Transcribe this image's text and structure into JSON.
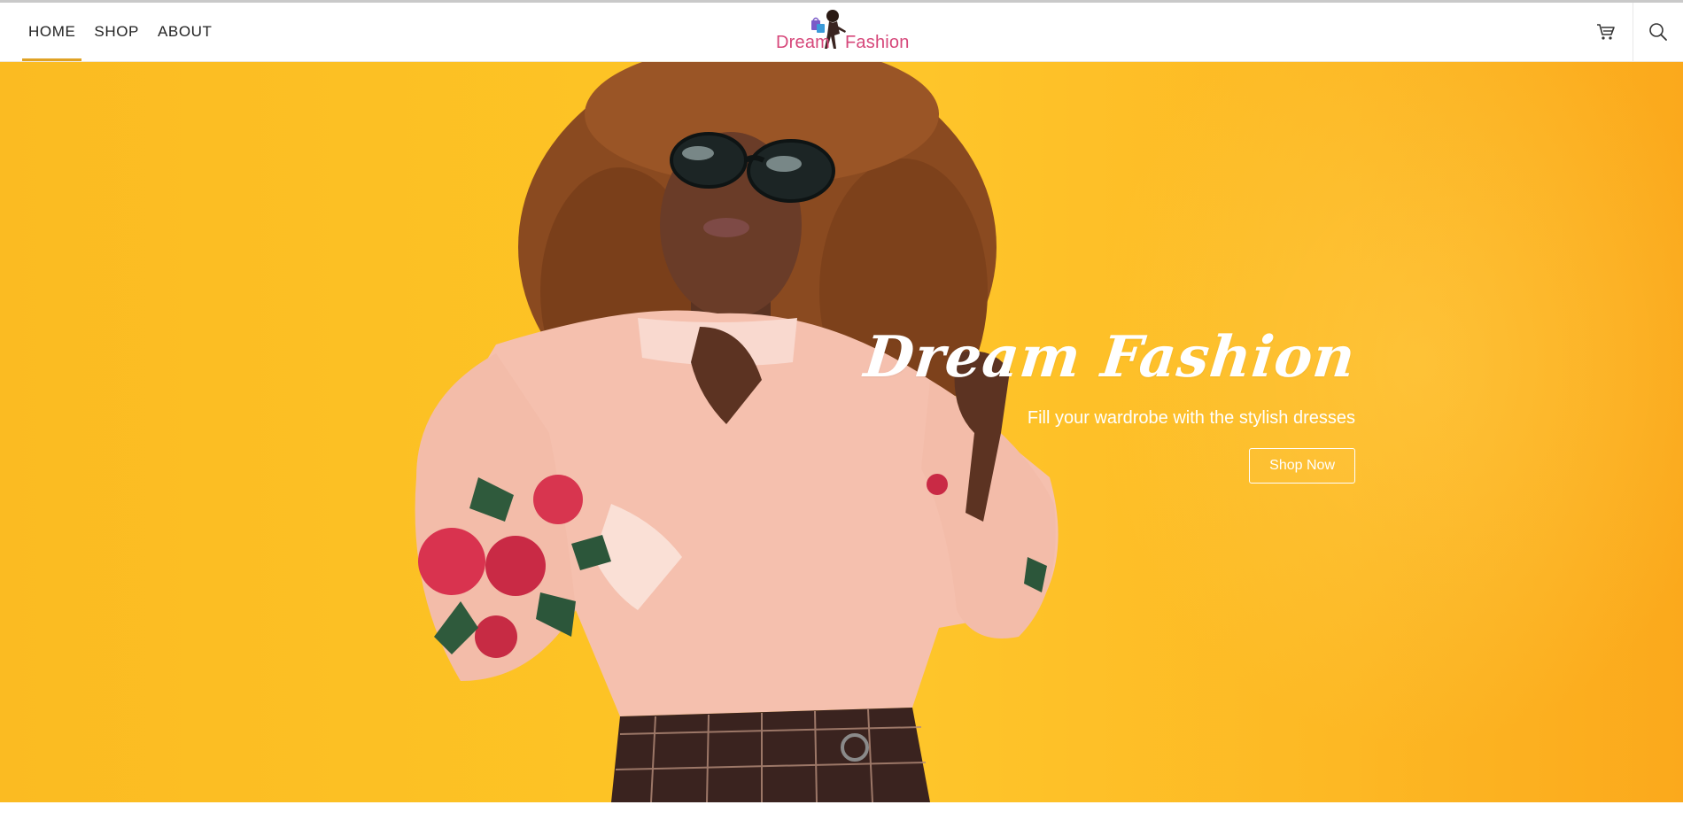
{
  "header": {
    "nav": [
      {
        "label": "HOME",
        "active": true
      },
      {
        "label": "SHOP",
        "active": false
      },
      {
        "label": "ABOUT",
        "active": false
      }
    ],
    "logo": {
      "word_left": "Dream",
      "word_right": "Fashion",
      "color": "#d6477a"
    },
    "icons": {
      "cart": "cart-icon",
      "search": "search-icon"
    },
    "accent_color": "#e0a325"
  },
  "hero": {
    "title": "Dream Fashion",
    "subtitle": "Fill your wardrobe with the stylish dresses",
    "button_label": "Shop Now",
    "background_color": "#fdc325"
  }
}
